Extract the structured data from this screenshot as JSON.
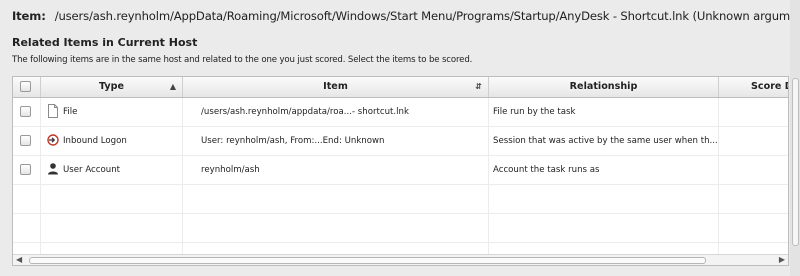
{
  "item": {
    "label": "Item:",
    "value": "/users/ash.reynholm/AppData/Roaming/Microsoft/Windows/Start Menu/Programs/Startup/AnyDesk - Shortcut.lnk (Unknown arguments)"
  },
  "section": {
    "title": "Related Items in Current Host",
    "description": "The following items are in the same host and related to the one you just scored. Select the items to be scored."
  },
  "table": {
    "columns": [
      "Type",
      "Item",
      "Relationship",
      "Score D"
    ],
    "sort_icons": {
      "type": "▲",
      "item": "⇵"
    },
    "rows": [
      {
        "type": "File",
        "icon": "file-icon",
        "item": "/users/ash.reynholm/appdata/roa...- shortcut.lnk",
        "relationship": "File run by the task"
      },
      {
        "type": "Inbound Logon",
        "icon": "inbound-logon-icon",
        "item": "User: reynholm/ash, From:...End: Unknown",
        "relationship": "Session that was active by the same user when th..."
      },
      {
        "type": "User Account",
        "icon": "user-icon",
        "item": "reynholm/ash",
        "relationship": "Account the task runs as"
      }
    ]
  },
  "scroll_arrows": {
    "left": "◀",
    "right": "▶"
  }
}
